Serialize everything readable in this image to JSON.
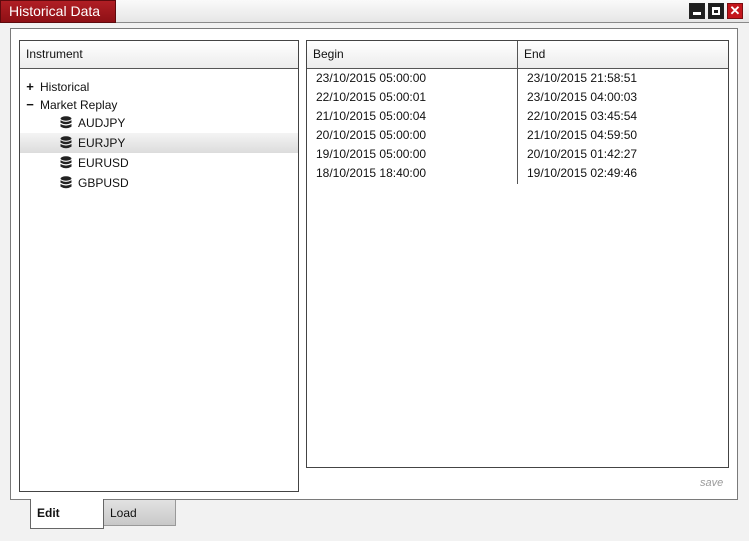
{
  "window": {
    "title": "Historical Data"
  },
  "instruments": {
    "header": "Instrument",
    "groups": [
      {
        "toggle": "+",
        "label": "Historical"
      },
      {
        "toggle": "−",
        "label": "Market Replay"
      }
    ],
    "items": [
      "AUDJPY",
      "EURJPY",
      "EURUSD",
      "GBPUSD"
    ],
    "selected": "EURJPY",
    "item_icon": "database-icon"
  },
  "dates": {
    "headers": {
      "begin": "Begin",
      "end": "End"
    },
    "rows": [
      {
        "begin": "23/10/2015 05:00:00",
        "end": "23/10/2015 21:58:51"
      },
      {
        "begin": "22/10/2015 05:00:01",
        "end": "23/10/2015 04:00:03"
      },
      {
        "begin": "21/10/2015 05:00:04",
        "end": "22/10/2015 03:45:54"
      },
      {
        "begin": "20/10/2015 05:00:00",
        "end": "21/10/2015 04:59:50"
      },
      {
        "begin": "19/10/2015 05:00:00",
        "end": "20/10/2015 01:42:27"
      },
      {
        "begin": "18/10/2015 18:40:00",
        "end": "19/10/2015 02:49:46"
      }
    ]
  },
  "actions": {
    "save_label": "save"
  },
  "tabs": [
    {
      "label": "Edit",
      "active": true
    },
    {
      "label": "Load",
      "active": false
    }
  ],
  "colors": {
    "title_accent": "#a0181e",
    "close_button": "#c4161c"
  }
}
